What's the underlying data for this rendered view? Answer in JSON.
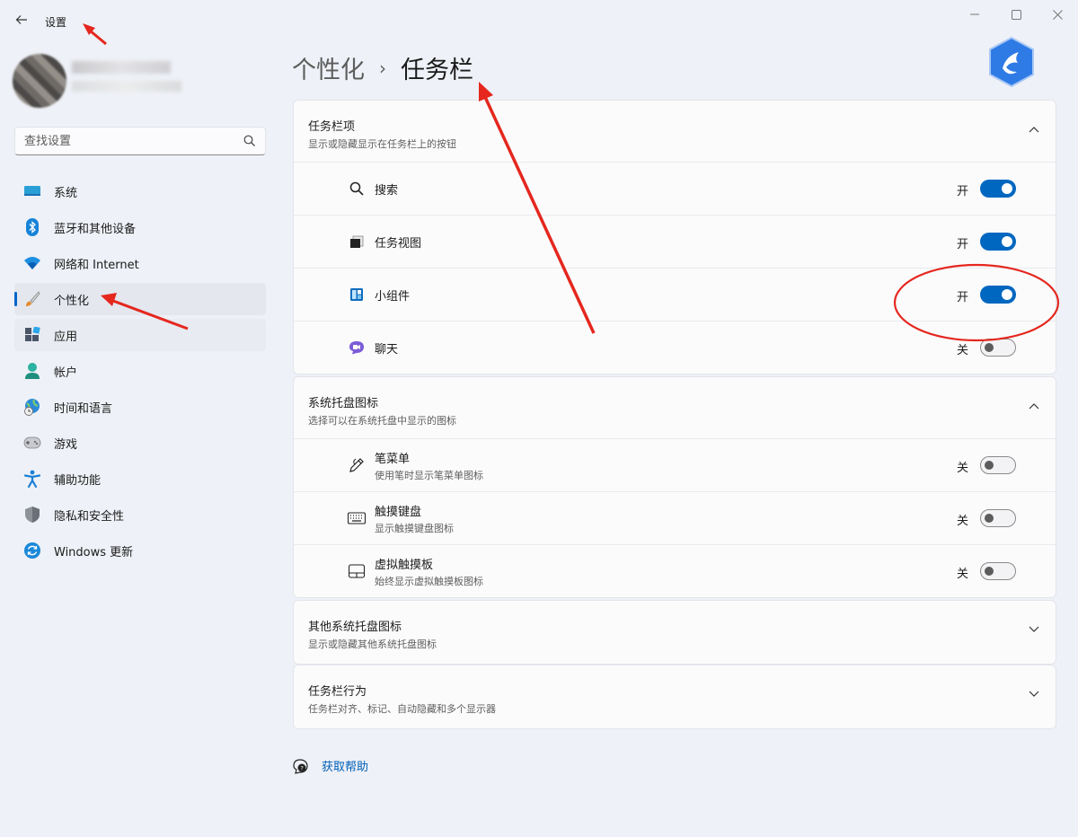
{
  "window": {
    "title": "设置"
  },
  "search": {
    "placeholder": "查找设置"
  },
  "sidebar": {
    "items": [
      {
        "label": "系统",
        "icon": "monitor-icon"
      },
      {
        "label": "蓝牙和其他设备",
        "icon": "bluetooth-icon"
      },
      {
        "label": "网络和 Internet",
        "icon": "wifi-icon"
      },
      {
        "label": "个性化",
        "icon": "paintbrush-icon",
        "active": true
      },
      {
        "label": "应用",
        "icon": "apps-icon"
      },
      {
        "label": "帐户",
        "icon": "account-icon"
      },
      {
        "label": "时间和语言",
        "icon": "globe-clock-icon"
      },
      {
        "label": "游戏",
        "icon": "gamepad-icon"
      },
      {
        "label": "辅助功能",
        "icon": "accessibility-icon"
      },
      {
        "label": "隐私和安全性",
        "icon": "shield-icon"
      },
      {
        "label": "Windows 更新",
        "icon": "refresh-icon"
      }
    ]
  },
  "breadcrumb": {
    "parent": "个性化",
    "separator": "›",
    "current": "任务栏"
  },
  "sections": {
    "taskbar_items": {
      "title": "任务栏项",
      "subtitle": "显示或隐藏显示在任务栏上的按钮",
      "rows": [
        {
          "label": "搜索",
          "state": "开",
          "on": true,
          "icon": "search-icon"
        },
        {
          "label": "任务视图",
          "state": "开",
          "on": true,
          "icon": "task-view-icon"
        },
        {
          "label": "小组件",
          "state": "开",
          "on": true,
          "icon": "widgets-icon"
        },
        {
          "label": "聊天",
          "state": "关",
          "on": false,
          "icon": "chat-icon"
        }
      ]
    },
    "tray_icons": {
      "title": "系统托盘图标",
      "subtitle": "选择可以在系统托盘中显示的图标",
      "rows": [
        {
          "label": "笔菜单",
          "desc": "使用笔时显示笔菜单图标",
          "state": "关",
          "on": false,
          "icon": "pen-icon"
        },
        {
          "label": "触摸键盘",
          "desc": "显示触摸键盘图标",
          "state": "关",
          "on": false,
          "icon": "keyboard-icon"
        },
        {
          "label": "虚拟触摸板",
          "desc": "始终显示虚拟触摸板图标",
          "state": "关",
          "on": false,
          "icon": "touchpad-icon"
        }
      ]
    },
    "other_tray": {
      "title": "其他系统托盘图标",
      "subtitle": "显示或隐藏其他系统托盘图标"
    },
    "behaviors": {
      "title": "任务栏行为",
      "subtitle": "任务栏对齐、标记、自动隐藏和多个显示器"
    }
  },
  "help": {
    "label": "获取帮助"
  },
  "colors": {
    "accent": "#0067c0",
    "annotation": "#e5271e"
  }
}
